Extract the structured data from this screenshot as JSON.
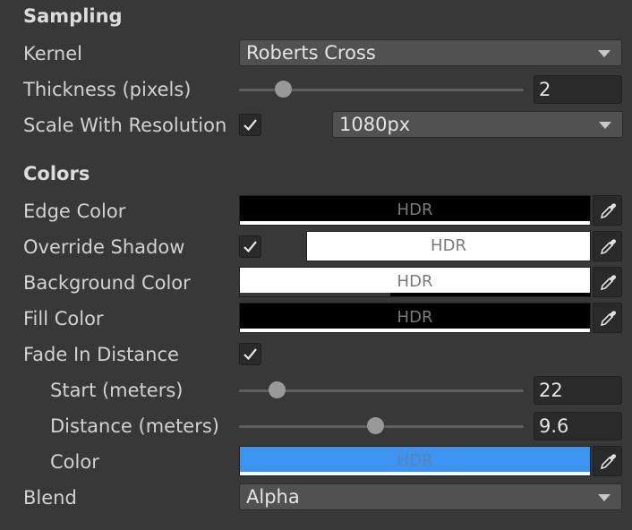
{
  "sampling": {
    "title": "Sampling",
    "kernel": {
      "label": "Kernel",
      "value": "Roberts Cross"
    },
    "thickness": {
      "label": "Thickness (pixels)",
      "value": "2",
      "slider_fraction": 0.16
    },
    "scale_with_resolution": {
      "label": "Scale With Resolution",
      "checked": true,
      "resolution": "1080px"
    }
  },
  "colors": {
    "title": "Colors",
    "edge_color": {
      "label": "Edge Color",
      "hdr": "HDR",
      "color": "#000000"
    },
    "override_shadow": {
      "label": "Override Shadow",
      "checked": true,
      "hdr": "HDR",
      "color": "#ffffff"
    },
    "background_color": {
      "label": "Background Color",
      "hdr": "HDR",
      "color": "#ffffff"
    },
    "fill_color": {
      "label": "Fill Color",
      "hdr": "HDR",
      "color": "#000000"
    },
    "fade_in_distance": {
      "label": "Fade In Distance",
      "checked": true
    },
    "start": {
      "label": "Start (meters)",
      "value": "22",
      "slider_fraction": 0.13
    },
    "distance": {
      "label": "Distance (meters)",
      "value": "9.6",
      "slider_fraction": 0.48
    },
    "fade_color": {
      "label": "Color",
      "hdr": "HDR",
      "color": "#3c94f0"
    },
    "blend": {
      "label": "Blend",
      "value": "Alpha"
    }
  },
  "icons": {
    "checkmark": "checkmark-icon",
    "picker": "eyedropper-icon",
    "dropdown": "chevron-down-icon"
  }
}
